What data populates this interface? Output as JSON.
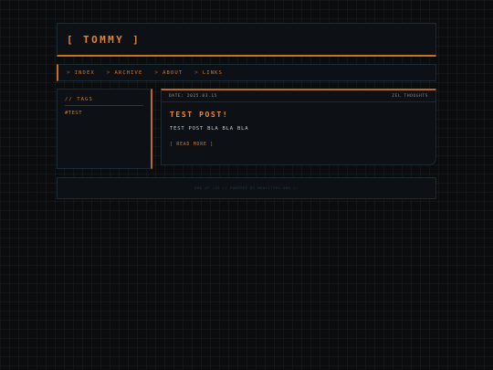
{
  "header": {
    "title": "[ TOMMY ]"
  },
  "nav": {
    "chevron": ">",
    "items": [
      {
        "label": "INDEX"
      },
      {
        "label": "ARCHIVE"
      },
      {
        "label": "ABOUT"
      },
      {
        "label": "LINKS"
      }
    ]
  },
  "sidebar": {
    "title": "// TAGS",
    "tags": [
      {
        "label": "#TEST"
      }
    ]
  },
  "post": {
    "date": "DATE: 2025.03.15",
    "category": "ZEL THOUGHTS",
    "title": "TEST POST!",
    "body": "TEST POST BLA BLA BLA",
    "read_more": "[ READ MORE ]"
  },
  "footer": {
    "text": "END OF LOG // POWERED BY NEOCITIES.ORG //"
  },
  "colors": {
    "accent": "#e2822a",
    "background": "#0b0c0d",
    "panel": "#0d1115",
    "border": "#1c2a33"
  }
}
